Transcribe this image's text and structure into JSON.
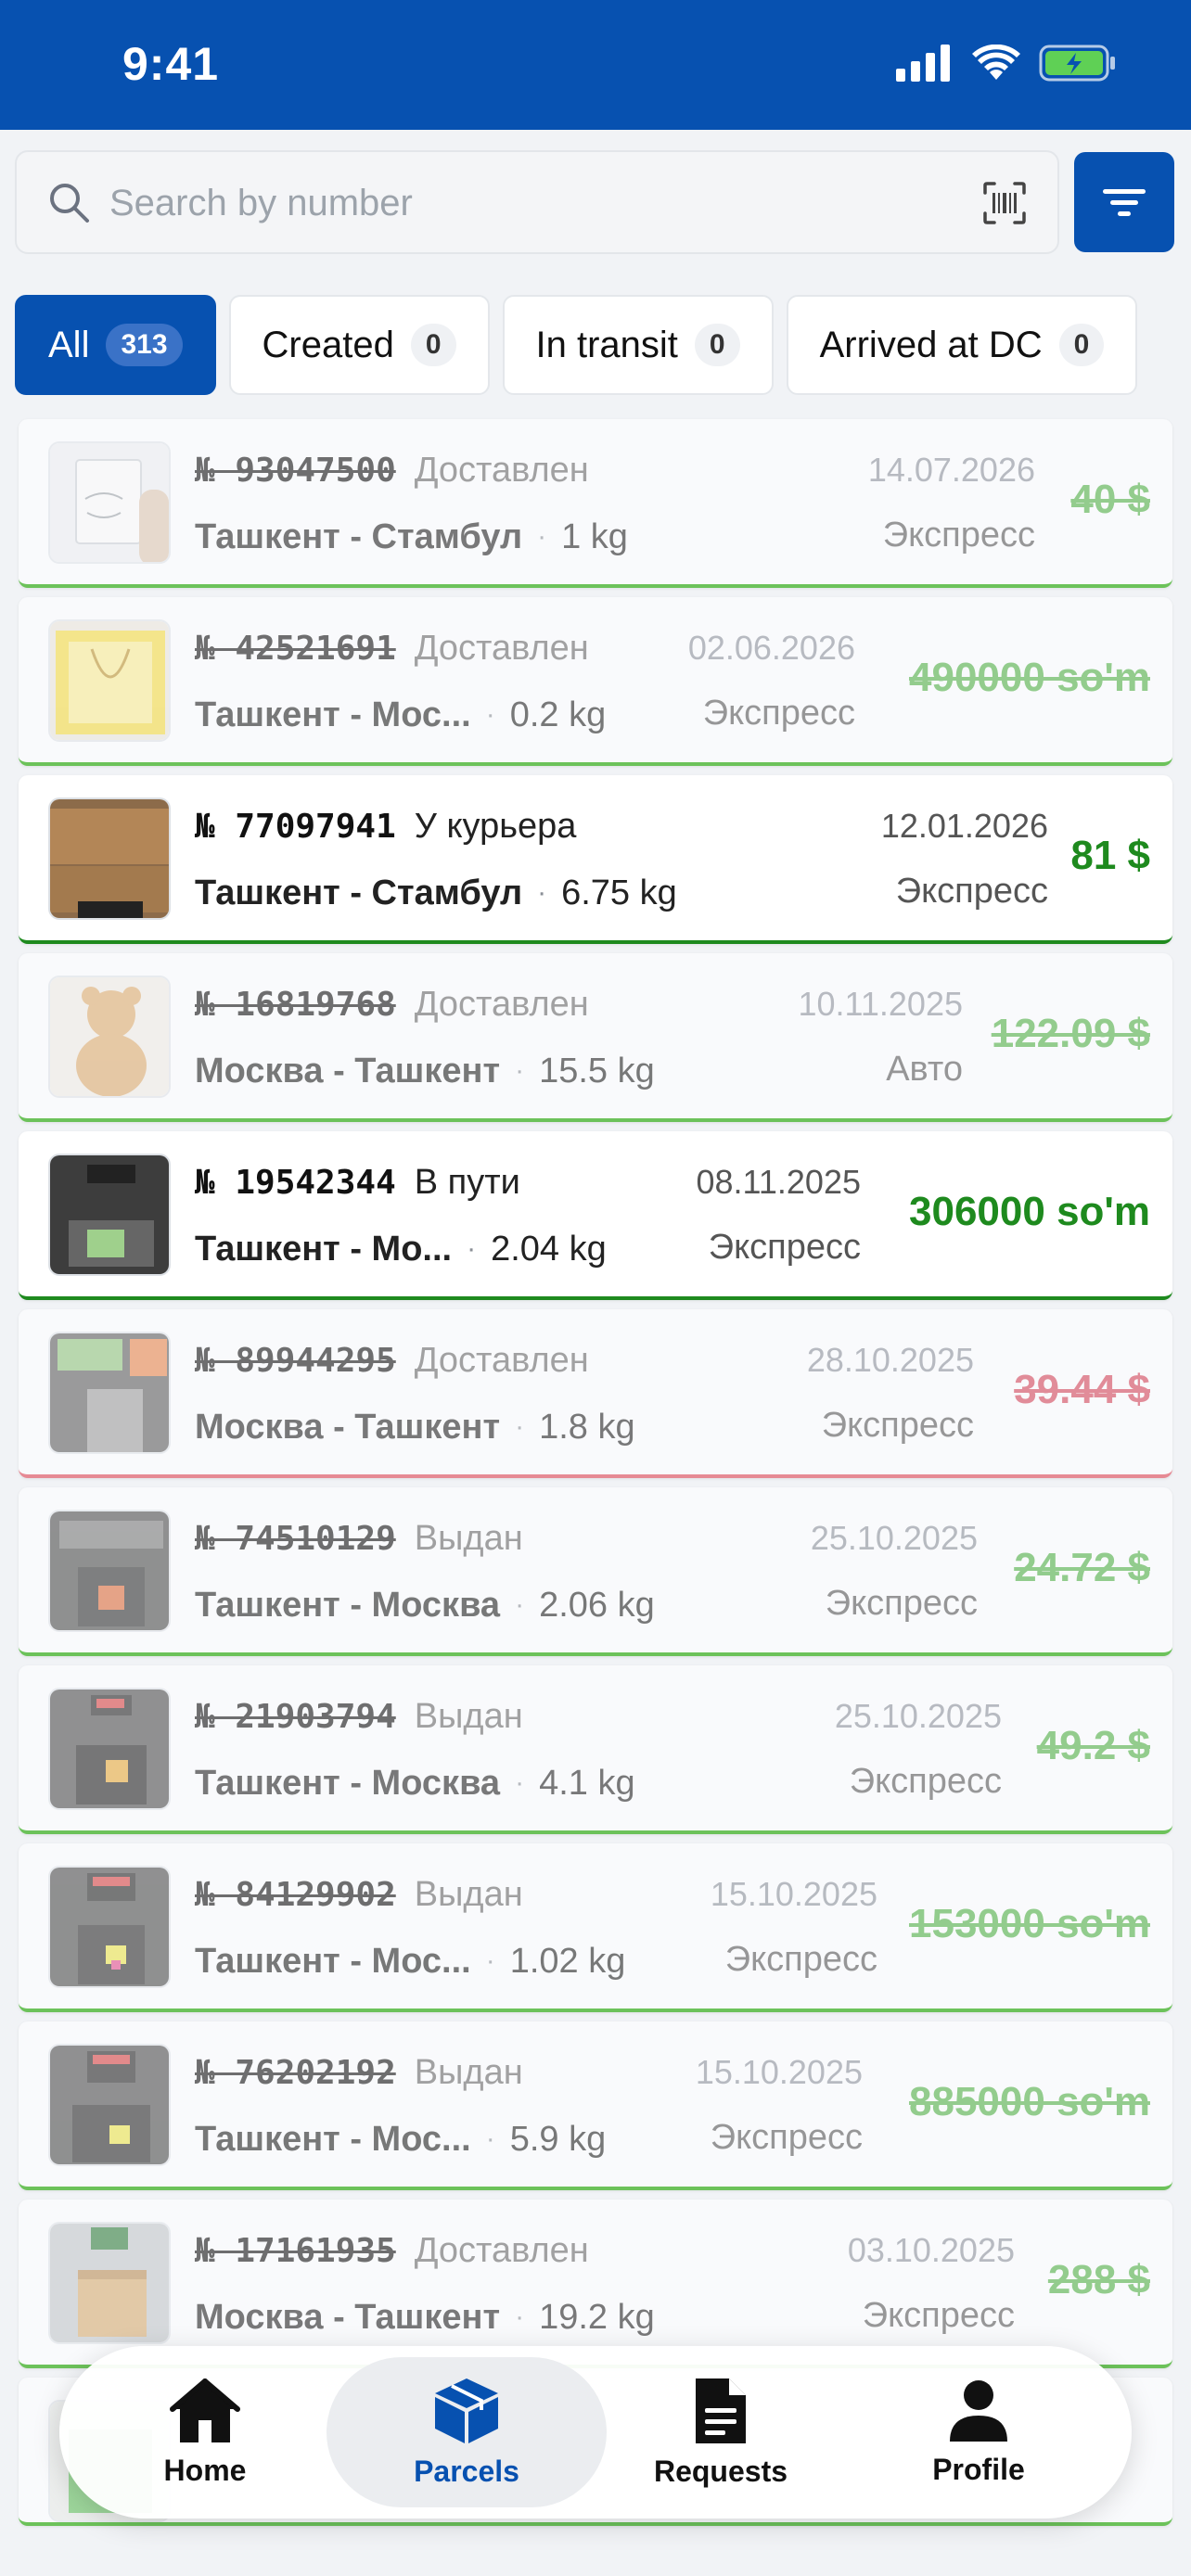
{
  "status_bar": {
    "time": "9:41"
  },
  "search": {
    "placeholder": "Search by number"
  },
  "colors": {
    "brand": "#0751b0",
    "delivered_line": "#6cc25a",
    "active_price": "#1e8a1e",
    "overdue": "#d14457"
  },
  "tabs": [
    {
      "label": "All",
      "count": "313",
      "active": true
    },
    {
      "label": "Created",
      "count": "0"
    },
    {
      "label": "In transit",
      "count": "0"
    },
    {
      "label": "Arrived at DC",
      "count": "0"
    }
  ],
  "parcels": [
    {
      "number": "№ 93047500",
      "status": "Доставлен",
      "date": "14.07.2026",
      "route": "Ташкент - Стамбул",
      "weight": "1 kg",
      "type": "Экспресс",
      "price": "40 $",
      "state": "faded"
    },
    {
      "number": "№ 42521691",
      "status": "Доставлен",
      "date": "02.06.2026",
      "route": "Ташкент - Мос...",
      "weight": "0.2 kg",
      "type": "Экспресс",
      "price": "490000 so'm",
      "state": "faded"
    },
    {
      "number": "№ 77097941",
      "status": "У курьера",
      "date": "12.01.2026",
      "route": "Ташкент - Стамбул",
      "weight": "6.75 kg",
      "type": "Экспресс",
      "price": "81 $",
      "state": "active"
    },
    {
      "number": "№ 16819768",
      "status": "Доставлен",
      "date": "10.11.2025",
      "route": "Москва - Ташкент",
      "weight": "15.5 kg",
      "type": "Авто",
      "price": "122.09 $",
      "state": "faded"
    },
    {
      "number": "№ 19542344",
      "status": "В пути",
      "date": "08.11.2025",
      "route": "Ташкент - Мо...",
      "weight": "2.04 kg",
      "type": "Экспресс",
      "price": "306000 so'm",
      "state": "active"
    },
    {
      "number": "№ 89944295",
      "status": "Доставлен",
      "date": "28.10.2025",
      "route": "Москва - Ташкент",
      "weight": "1.8 kg",
      "type": "Экспресс",
      "price": "39.44 $",
      "state": "red"
    },
    {
      "number": "№ 74510129",
      "status": "Выдан",
      "date": "25.10.2025",
      "route": "Ташкент - Москва",
      "weight": "2.06 kg",
      "type": "Экспресс",
      "price": "24.72 $",
      "state": "faded"
    },
    {
      "number": "№ 21903794",
      "status": "Выдан",
      "date": "25.10.2025",
      "route": "Ташкент - Москва",
      "weight": "4.1 kg",
      "type": "Экспресс",
      "price": "49.2 $",
      "state": "faded"
    },
    {
      "number": "№ 84129902",
      "status": "Выдан",
      "date": "15.10.2025",
      "route": "Ташкент - Мос...",
      "weight": "1.02 kg",
      "type": "Экспресс",
      "price": "153000 so'm",
      "state": "faded"
    },
    {
      "number": "№ 76202192",
      "status": "Выдан",
      "date": "15.10.2025",
      "route": "Ташкент - Мос...",
      "weight": "5.9 kg",
      "type": "Экспресс",
      "price": "885000 so'm",
      "state": "faded"
    },
    {
      "number": "№ 17161935",
      "status": "Доставлен",
      "date": "03.10.2025",
      "route": "Москва - Ташкент",
      "weight": "19.2 kg",
      "type": "Экспресс",
      "price": "288 $",
      "state": "faded"
    }
  ],
  "nav": [
    {
      "label": "Home",
      "icon": "home-icon"
    },
    {
      "label": "Parcels",
      "icon": "box-icon",
      "selected": true
    },
    {
      "label": "Requests",
      "icon": "document-icon"
    },
    {
      "label": "Profile",
      "icon": "person-icon"
    }
  ]
}
